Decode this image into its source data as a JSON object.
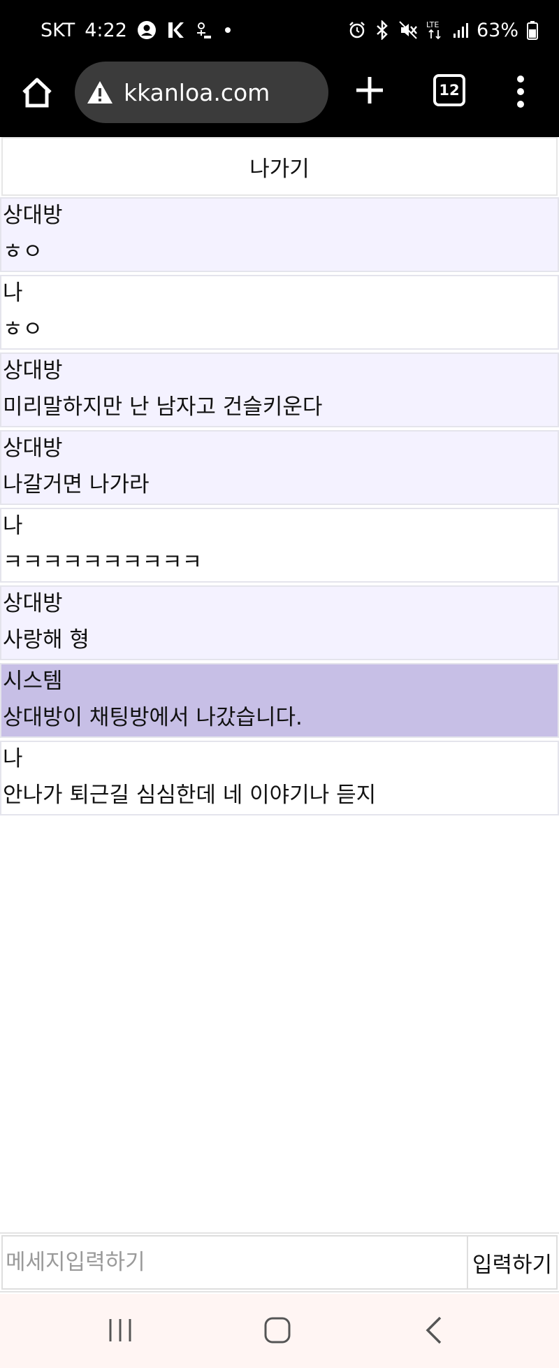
{
  "status_bar": {
    "carrier": "SKT",
    "time": "4:22",
    "battery": "63%",
    "network": "LTE"
  },
  "browser": {
    "url": "kkanloa.com",
    "tab_count": "12"
  },
  "page": {
    "exit_label": "나가기",
    "messages": [
      {
        "sender": "상대방",
        "text": "ㅎㅇ",
        "kind": "other"
      },
      {
        "sender": "나",
        "text": "ㅎㅇ",
        "kind": "me"
      },
      {
        "sender": "상대방",
        "text": "미리말하지만 난 남자고 건슬키운다",
        "kind": "other"
      },
      {
        "sender": "상대방",
        "text": "나갈거면 나가라",
        "kind": "other"
      },
      {
        "sender": "나",
        "text": "ㅋㅋㅋㅋㅋㅋㅋㅋㅋㅋ",
        "kind": "me"
      },
      {
        "sender": "상대방",
        "text": "사랑해 형",
        "kind": "other"
      },
      {
        "sender": "시스템",
        "text": "상대방이 채팅방에서 나갔습니다.",
        "kind": "system"
      },
      {
        "sender": "나",
        "text": "안나가 퇴근길 심심한데 네 이야기나 듣지",
        "kind": "me"
      }
    ],
    "input_placeholder": "메세지입력하기",
    "input_value": "",
    "send_label": "입력하기"
  },
  "colors": {
    "other_bg": "#f4f2ff",
    "me_bg": "#ffffff",
    "system_bg": "#c7bfe6"
  }
}
